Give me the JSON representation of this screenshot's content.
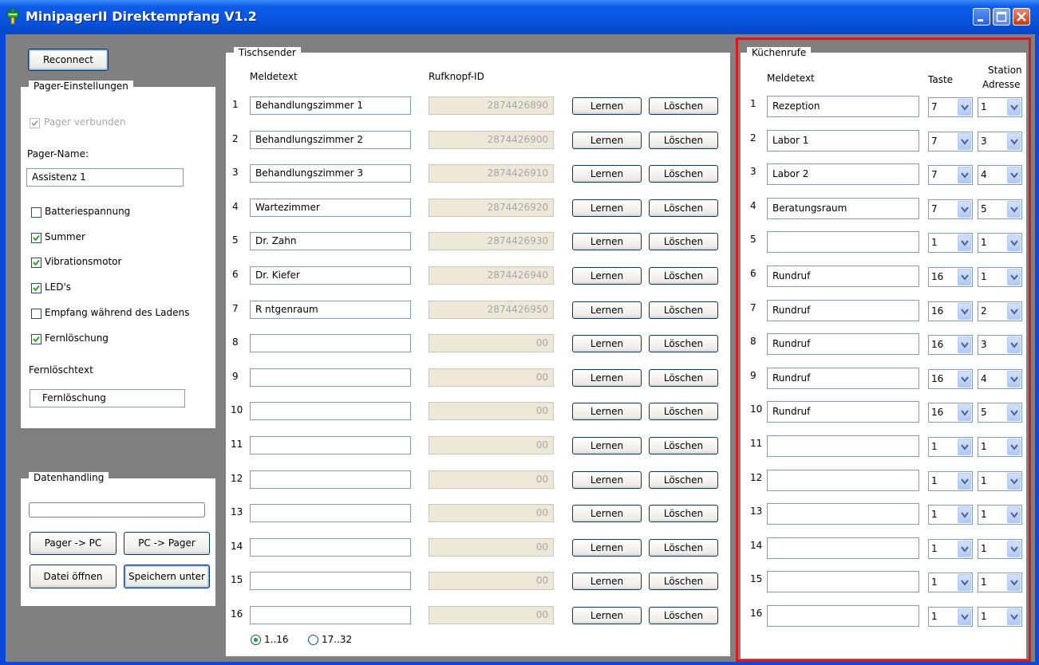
{
  "window": {
    "title": "MinipagerII Direktempfang V1.2"
  },
  "left": {
    "reconnect_label": "Reconnect",
    "pager_settings": {
      "group_label": "Pager-Einstellungen",
      "connected_label": "Pager verbunden",
      "name_label": "Pager-Name:",
      "name_value": "Assistenz 1",
      "options": [
        {
          "label": "Batteriespannung",
          "checked": false
        },
        {
          "label": "Summer",
          "checked": true
        },
        {
          "label": "Vibrationsmotor",
          "checked": true
        },
        {
          "label": "LED's",
          "checked": true
        },
        {
          "label": "Empfang während des Ladens",
          "checked": false
        },
        {
          "label": "Fernlöschung",
          "checked": true
        }
      ],
      "remote_text_label": "Fernlöschtext",
      "remote_text_value": "Fernlöschung"
    },
    "data_handling": {
      "group_label": "Datenhandling",
      "pager_to_pc": "Pager -> PC",
      "pc_to_pager": "PC -> Pager",
      "open_file": "Datei öffnen",
      "save_as": "Speichern unter"
    }
  },
  "table": {
    "group_label": "Tischsender",
    "col_message": "Meldetext",
    "col_id": "Rufknopf-ID",
    "learn_label": "Lernen",
    "delete_label": "Löschen",
    "rows": [
      {
        "num": "1",
        "text": "Behandlungszimmer 1",
        "id": "2874426890"
      },
      {
        "num": "2",
        "text": "Behandlungszimmer 2",
        "id": "2874426900"
      },
      {
        "num": "3",
        "text": "Behandlungszimmer 3",
        "id": "2874426910"
      },
      {
        "num": "4",
        "text": "Wartezimmer",
        "id": "2874426920"
      },
      {
        "num": "5",
        "text": "Dr. Zahn",
        "id": "2874426930"
      },
      {
        "num": "6",
        "text": "Dr. Kiefer",
        "id": "2874426940"
      },
      {
        "num": "7",
        "text": "R ntgenraum",
        "id": "2874426950"
      },
      {
        "num": "8",
        "text": "",
        "id": "00"
      },
      {
        "num": "9",
        "text": "",
        "id": "00"
      },
      {
        "num": "10",
        "text": "",
        "id": "00"
      },
      {
        "num": "11",
        "text": "",
        "id": "00"
      },
      {
        "num": "12",
        "text": "",
        "id": "00"
      },
      {
        "num": "13",
        "text": "",
        "id": "00"
      },
      {
        "num": "14",
        "text": "",
        "id": "00"
      },
      {
        "num": "15",
        "text": "",
        "id": "00"
      },
      {
        "num": "16",
        "text": "",
        "id": "00"
      }
    ],
    "range_options": [
      {
        "label": "1..16",
        "selected": true
      },
      {
        "label": "17..32",
        "selected": false
      }
    ]
  },
  "kitchen": {
    "group_label": "Küchenrufe",
    "col_message": "Meldetext",
    "col_key": "Taste",
    "col_station_1": "Station",
    "col_station_2": "Adresse",
    "rows": [
      {
        "num": "1",
        "text": "Rezeption",
        "key": "7",
        "station": "1"
      },
      {
        "num": "2",
        "text": "Labor 1",
        "key": "7",
        "station": "3"
      },
      {
        "num": "3",
        "text": "Labor 2",
        "key": "7",
        "station": "4"
      },
      {
        "num": "4",
        "text": "Beratungsraum",
        "key": "7",
        "station": "5"
      },
      {
        "num": "5",
        "text": "",
        "key": "1",
        "station": "1"
      },
      {
        "num": "6",
        "text": "Rundruf",
        "key": "16",
        "station": "1"
      },
      {
        "num": "7",
        "text": "Rundruf",
        "key": "16",
        "station": "2"
      },
      {
        "num": "8",
        "text": "Rundruf",
        "key": "16",
        "station": "3"
      },
      {
        "num": "9",
        "text": "Rundruf",
        "key": "16",
        "station": "4"
      },
      {
        "num": "10",
        "text": "Rundruf",
        "key": "16",
        "station": "5"
      },
      {
        "num": "11",
        "text": "",
        "key": "1",
        "station": "1"
      },
      {
        "num": "12",
        "text": "",
        "key": "1",
        "station": "1"
      },
      {
        "num": "13",
        "text": "",
        "key": "1",
        "station": "1"
      },
      {
        "num": "14",
        "text": "",
        "key": "1",
        "station": "1"
      },
      {
        "num": "15",
        "text": "",
        "key": "1",
        "station": "1"
      },
      {
        "num": "16",
        "text": "",
        "key": "1",
        "station": "1"
      }
    ]
  },
  "colors": {
    "highlight_border": "#e0141b",
    "titlebar": "#0754e1",
    "check": "#21a121"
  }
}
